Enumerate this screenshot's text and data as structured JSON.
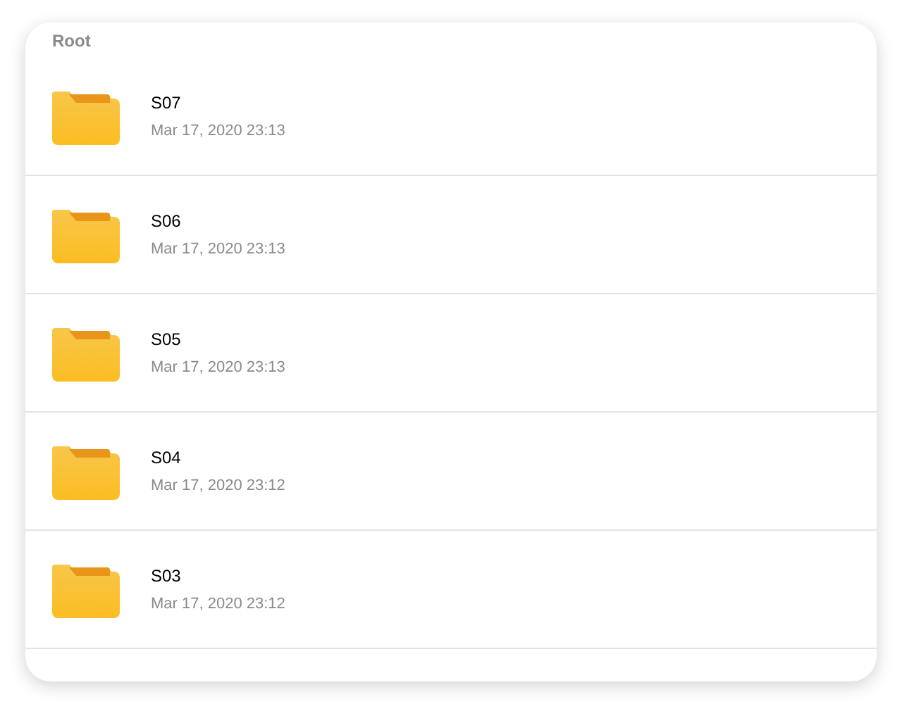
{
  "breadcrumb": "Root",
  "items": [
    {
      "name": "S07",
      "modified": "Mar 17, 2020 23:13"
    },
    {
      "name": "S06",
      "modified": "Mar 17, 2020 23:13"
    },
    {
      "name": "S05",
      "modified": "Mar 17, 2020 23:13"
    },
    {
      "name": "S04",
      "modified": "Mar 17, 2020 23:12"
    },
    {
      "name": "S03",
      "modified": "Mar 17, 2020 23:12"
    }
  ]
}
